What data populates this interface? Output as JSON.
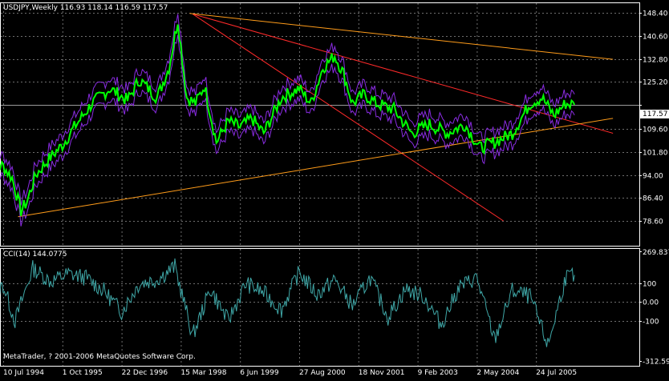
{
  "window": {
    "symbol": "USDJPY",
    "timeframe": "Weekly",
    "ohlc": "116.93 118.14 116.59 117.57",
    "title": "USDJPY,Weekly  116.93 118.14 116.59 117.57"
  },
  "indicator": {
    "title": "CCI(14) 144.0775"
  },
  "copyright": "MetaTrader, ? 2001-2006 MetaQuotes Software Corp.",
  "current_price_label": "117.57",
  "colors": {
    "background": "#000000",
    "grid": "#6e6e6e",
    "candles": "#00ff00",
    "envelope": "#8a2be2",
    "cci_line": "#3fa7a7",
    "trendline_red": "#ff2a2a",
    "trendline_orange": "#ff9c1a",
    "frame": "#ffffff"
  },
  "chart_data": [
    {
      "type": "line",
      "name": "price",
      "title": "USDJPY,Weekly  116.93 118.14 116.59 117.57",
      "y_ticks": [
        "148.40",
        "140.60",
        "132.80",
        "125.20",
        "117.57",
        "109.60",
        "101.80",
        "94.00",
        "86.40",
        "78.60"
      ],
      "y_tick_values": [
        148.4,
        140.6,
        132.8,
        125.2,
        117.57,
        109.6,
        101.8,
        94.0,
        86.4,
        78.6
      ],
      "ylim": [
        78.6,
        148.4
      ],
      "x_ticks": [
        "10 Jul 1994",
        "1 Oct 1995",
        "22 Dec 1996",
        "15 Mar 1998",
        "6 Jun 1999",
        "27 Aug 2000",
        "18 Nov 2001",
        "9 Feb 2003",
        "2 May 2004",
        "24 Jul 2005"
      ],
      "x_tick_positions": [
        0,
        1,
        2,
        3,
        4,
        5,
        6,
        7,
        8,
        9
      ],
      "x": [
        -0.3,
        0.0,
        0.15,
        0.3,
        0.4,
        0.55,
        0.8,
        1.0,
        1.2,
        1.5,
        1.8,
        2.1,
        2.3,
        2.6,
        2.8,
        2.95,
        3.1,
        3.25,
        3.4,
        3.6,
        3.8,
        4.0,
        4.2,
        4.4,
        4.7,
        5.0,
        5.2,
        5.4,
        5.6,
        5.75,
        5.9,
        6.1,
        6.3,
        6.6,
        6.9,
        7.2,
        7.5,
        7.8,
        8.05,
        8.3,
        8.6,
        8.9,
        9.1,
        9.3,
        9.5,
        9.65
      ],
      "values": [
        98,
        97,
        93,
        82,
        85,
        94,
        100,
        104,
        110,
        118,
        123,
        119,
        126,
        120,
        130,
        146,
        120,
        118,
        124,
        105,
        112,
        110,
        113,
        108,
        120,
        123,
        118,
        130,
        134,
        128,
        118,
        121,
        118,
        116,
        108,
        111,
        108,
        111,
        103,
        105,
        108,
        118,
        120,
        114,
        118,
        117.57
      ]
    },
    {
      "type": "line",
      "name": "CCI",
      "title": "CCI(14) 144.0775",
      "y_ticks": [
        "269.837",
        "100",
        "0.00",
        "-100",
        "-312.591"
      ],
      "y_tick_values": [
        269.837,
        100,
        0,
        -100,
        -312.591
      ],
      "ylim": [
        -312.591,
        269.837
      ],
      "x": [
        -0.3,
        0.0,
        0.2,
        0.5,
        0.8,
        1.1,
        1.4,
        1.7,
        2.0,
        2.3,
        2.6,
        2.9,
        3.2,
        3.5,
        3.8,
        4.1,
        4.4,
        4.7,
        5.0,
        5.3,
        5.6,
        5.9,
        6.2,
        6.5,
        6.8,
        7.1,
        7.4,
        7.7,
        8.0,
        8.3,
        8.6,
        8.9,
        9.2,
        9.5,
        9.65
      ],
      "values": [
        20,
        90,
        -100,
        180,
        110,
        150,
        130,
        60,
        -50,
        100,
        120,
        190,
        -180,
        70,
        -100,
        100,
        50,
        -40,
        160,
        40,
        120,
        -20,
        130,
        -80,
        70,
        30,
        -120,
        80,
        130,
        -200,
        60,
        30,
        -230,
        130,
        144
      ]
    }
  ],
  "trendlines": [
    {
      "name": "red-upper",
      "color": "red",
      "from": [
        3.2,
        148.0
      ],
      "to": [
        10.3,
        108.0
      ]
    },
    {
      "name": "red-lower",
      "color": "red",
      "from": [
        3.2,
        148.0
      ],
      "to": [
        8.45,
        78.6
      ]
    },
    {
      "name": "orange-upper",
      "color": "orange",
      "from": [
        3.15,
        148.2
      ],
      "to": [
        10.3,
        132.8
      ]
    },
    {
      "name": "orange-lower",
      "color": "orange",
      "from": [
        0.25,
        80.0
      ],
      "to": [
        10.3,
        113.0
      ]
    }
  ]
}
